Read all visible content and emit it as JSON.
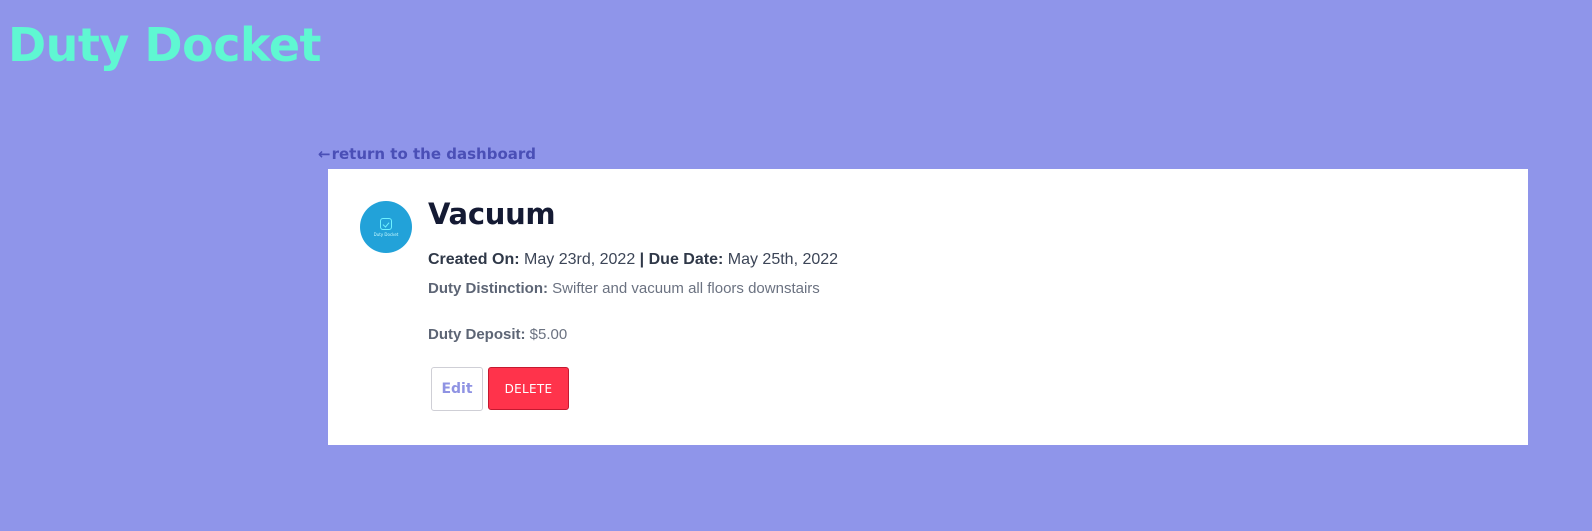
{
  "app": {
    "title": "Duty Docket"
  },
  "nav": {
    "back_arrow": "←",
    "back_link": "return to the dashboard"
  },
  "duty": {
    "title": "Vacuum",
    "avatar_text": "Duty Docket",
    "created_label": "Created On:",
    "created_value": "May 23rd, 2022",
    "separator": "|",
    "due_label": "Due Date:",
    "due_value": "May 25th, 2022",
    "distinction_label": "Duty Distinction:",
    "distinction_value": "Swifter and vacuum all floors downstairs",
    "deposit_label": "Duty Deposit:",
    "deposit_value": "$5.00"
  },
  "actions": {
    "edit_label": "Edit",
    "delete_label": "DELETE"
  },
  "colors": {
    "background": "#8f95ea",
    "title": "#5ff7d2",
    "link": "#4a4fb6",
    "card": "#ffffff",
    "delete": "#ff334b",
    "avatar": "#22a2d9"
  },
  "icons": {
    "back": "left-arrow-icon",
    "avatar": "duty-docket-logo-icon"
  }
}
